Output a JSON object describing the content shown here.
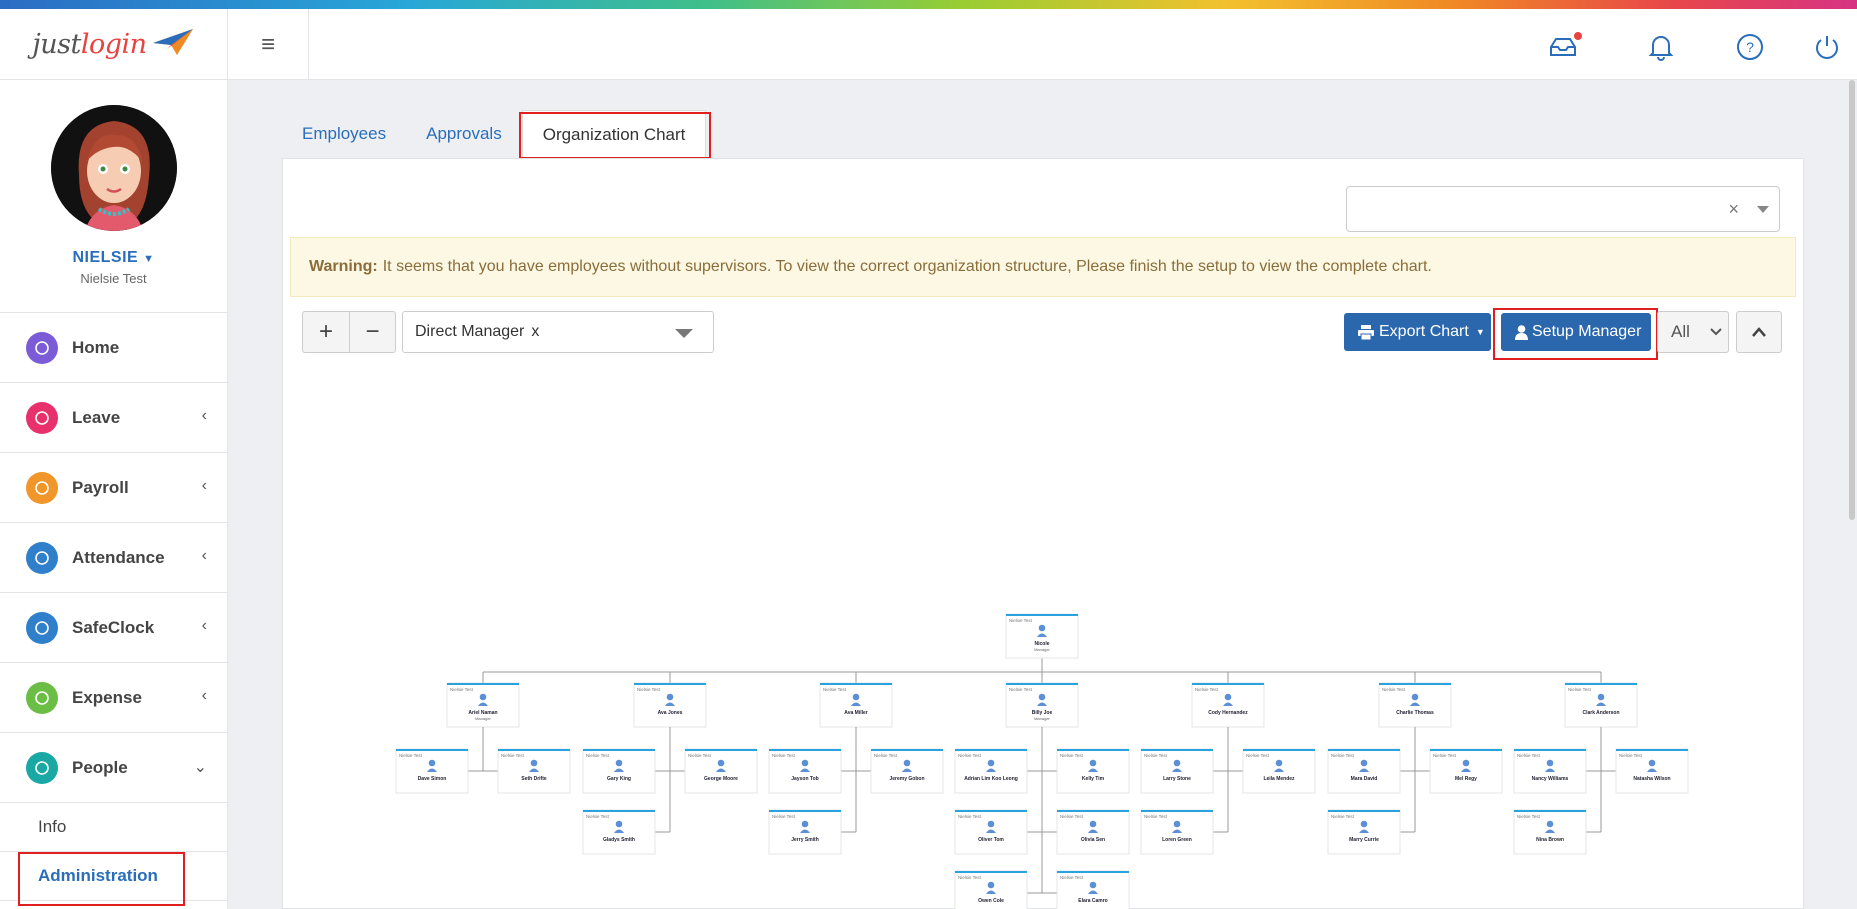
{
  "header": {
    "logo": {
      "part1": "just",
      "part2": "login"
    },
    "icons": [
      "inbox-icon",
      "bell-icon",
      "help-icon",
      "power-icon"
    ]
  },
  "profile": {
    "name": "NIELSIE",
    "subtitle": "Nielsie Test"
  },
  "nav": {
    "items": [
      {
        "label": "Home",
        "color": "#7b5cd6",
        "icon": "home-icon"
      },
      {
        "label": "Leave",
        "color": "#e8306d",
        "icon": "calendar-icon"
      },
      {
        "label": "Payroll",
        "color": "#f0962a",
        "icon": "payroll-icon"
      },
      {
        "label": "Attendance",
        "color": "#2f7fcb",
        "icon": "clock-icon"
      },
      {
        "label": "SafeClock",
        "color": "#2f7fcb",
        "icon": "clock-icon"
      },
      {
        "label": "Expense",
        "color": "#6cbd45",
        "icon": "receipt-icon"
      },
      {
        "label": "People",
        "color": "#19a8a4",
        "icon": "people-icon"
      }
    ],
    "sub_items": [
      {
        "label": "Info"
      },
      {
        "label": "Administration"
      }
    ]
  },
  "tabs": [
    {
      "label": "Employees"
    },
    {
      "label": "Approvals"
    },
    {
      "label": "Organization Chart"
    }
  ],
  "warning": {
    "bold": "Warning:",
    "text": "It seems that you have employees without supervisors. To view the correct organization structure, Please finish the setup to view the complete chart."
  },
  "toolbar": {
    "zoom_in": "+",
    "zoom_out": "−",
    "filter_value": "Direct Manager",
    "filter_remove": "x",
    "export_label": "Export Chart",
    "setup_label": "Setup Manager",
    "all_label": "All"
  },
  "org": {
    "card_header": "Nielsie Test",
    "root": {
      "name": "Nicole",
      "title": "Manager"
    },
    "managers": [
      {
        "name": "Ariel Naman",
        "title": "Manager",
        "reports": [
          "Dave Simon",
          "Seth Drifte"
        ]
      },
      {
        "name": "Ava Jones",
        "title": "",
        "reports": [
          "Gary King",
          "George Moore",
          "Gladys Smith"
        ]
      },
      {
        "name": "Ava Miller",
        "title": "",
        "reports": [
          "Jayson Tob",
          "Jeremy Gobon",
          "Jerry Smith"
        ]
      },
      {
        "name": "Billy Joe",
        "title": "Manager",
        "reports": [
          "Adrian Lim Koo Leong",
          "Kelly Tim",
          "Oliver Tom",
          "Olivia Sen",
          "Owen Cole",
          "Elara Camro"
        ]
      },
      {
        "name": "Cody Hernandez",
        "title": "",
        "reports": [
          "Larry Stone",
          "Leila Mendez",
          "Loren Green"
        ]
      },
      {
        "name": "Charlie Thomas",
        "title": "",
        "reports": [
          "Mara David",
          "Mel Regy",
          "Marry Currie"
        ]
      },
      {
        "name": "Clark Anderson",
        "title": "",
        "reports": [
          "Nancy Williams",
          "Natasha Wilson",
          "Nina Brown"
        ]
      }
    ]
  }
}
